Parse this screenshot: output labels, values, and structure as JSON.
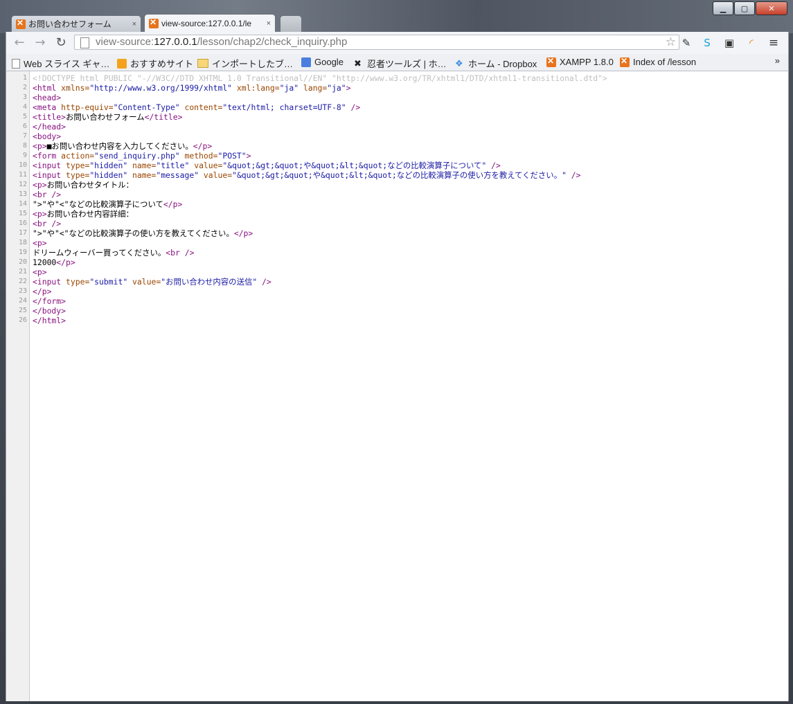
{
  "window": {
    "controls": [
      "▁",
      "▢",
      "✕"
    ]
  },
  "tabs": [
    {
      "title": "お問い合わせフォーム",
      "close": "×",
      "active": false
    },
    {
      "title": "view-source:127.0.0.1/le",
      "close": "×",
      "active": true
    }
  ],
  "toolbar": {
    "back_icon": "←",
    "forward_icon": "→",
    "reload_icon": "↻",
    "url_prefix": "view-source:",
    "url_host": "127.0.0.1",
    "url_path": "/lesson/chap2/check_inquiry.php",
    "star_icon": "☆",
    "extensions": [
      "eyedropper-icon",
      "skype-icon",
      "evernote-icon",
      "rss-icon",
      "menu-icon"
    ]
  },
  "bookmarks": [
    {
      "label": "Web スライス ギャ…",
      "icon": "page-icon"
    },
    {
      "label": "おすすめサイト",
      "icon": "bookmark-orange-icon"
    },
    {
      "label": "インポートしたブ…",
      "icon": "folder-icon"
    },
    {
      "label": "Google",
      "icon": "google-icon"
    },
    {
      "label": "忍者ツールズ | ホ…",
      "icon": "ninja-icon"
    },
    {
      "label": "ホーム - Dropbox",
      "icon": "dropbox-icon"
    },
    {
      "label": "XAMPP 1.8.0",
      "icon": "xampp-icon"
    },
    {
      "label": "Index of /lesson",
      "icon": "xampp-icon"
    }
  ],
  "bookmarks_more": "»",
  "source_lines": [
    {
      "n": "1",
      "parts": [
        [
          "doc",
          "<!DOCTYPE html PUBLIC \"-//W3C//DTD XHTML 1.0 Transitional//EN\" \"http://www.w3.org/TR/xhtml1/DTD/xhtml1-transitional.dtd\">"
        ]
      ]
    },
    {
      "n": "2",
      "parts": [
        [
          "tag",
          "<html "
        ],
        [
          "attr",
          "xmlns="
        ],
        [
          "val",
          "\"http://www.w3.org/1999/xhtml\""
        ],
        [
          "attr",
          " xml:lang="
        ],
        [
          "val",
          "\"ja\""
        ],
        [
          "attr",
          " lang="
        ],
        [
          "val",
          "\"ja\""
        ],
        [
          "tag",
          ">"
        ]
      ]
    },
    {
      "n": "3",
      "parts": [
        [
          "tag",
          "<head>"
        ]
      ]
    },
    {
      "n": "4",
      "parts": [
        [
          "tag",
          "<meta "
        ],
        [
          "attr",
          "http-equiv="
        ],
        [
          "val",
          "\"Content-Type\""
        ],
        [
          "attr",
          " content="
        ],
        [
          "val",
          "\"text/html; charset=UTF-8\""
        ],
        [
          "tag",
          " />"
        ]
      ]
    },
    {
      "n": "5",
      "parts": [
        [
          "tag",
          "<title>"
        ],
        [
          "txt",
          "お問い合わせフォーム"
        ],
        [
          "tag",
          "</title>"
        ]
      ]
    },
    {
      "n": "6",
      "parts": [
        [
          "tag",
          "</head>"
        ]
      ]
    },
    {
      "n": "7",
      "parts": [
        [
          "tag",
          "<body>"
        ]
      ]
    },
    {
      "n": "8",
      "parts": [
        [
          "tag",
          "<p>"
        ],
        [
          "txt",
          "■お問い合わせ内容を入力してください。"
        ],
        [
          "tag",
          "</p>"
        ]
      ]
    },
    {
      "n": "9",
      "parts": [
        [
          "tag",
          "<form "
        ],
        [
          "attr",
          "action="
        ],
        [
          "val",
          "\"send_inquiry.php\""
        ],
        [
          "attr",
          " method="
        ],
        [
          "val",
          "\"POST\""
        ],
        [
          "tag",
          ">"
        ]
      ]
    },
    {
      "n": "10",
      "parts": [
        [
          "tag",
          "<input "
        ],
        [
          "attr",
          "type="
        ],
        [
          "val",
          "\"hidden\""
        ],
        [
          "attr",
          " name="
        ],
        [
          "val",
          "\"title\""
        ],
        [
          "attr",
          " value="
        ],
        [
          "val",
          "\"&quot;&gt;&quot;や&quot;&lt;&quot;などの比較演算子について\""
        ],
        [
          "tag",
          " />"
        ]
      ]
    },
    {
      "n": "11",
      "parts": [
        [
          "tag",
          "<input "
        ],
        [
          "attr",
          "type="
        ],
        [
          "val",
          "\"hidden\""
        ],
        [
          "attr",
          " name="
        ],
        [
          "val",
          "\"message\""
        ],
        [
          "attr",
          " value="
        ],
        [
          "val",
          "\"&quot;&gt;&quot;や&quot;&lt;&quot;などの比較演算子の使い方を教えてください。\""
        ],
        [
          "tag",
          " />"
        ]
      ]
    },
    {
      "n": "12",
      "parts": [
        [
          "tag",
          "<p>"
        ],
        [
          "txt",
          "お問い合わせタイトル："
        ]
      ]
    },
    {
      "n": "13",
      "parts": [
        [
          "tag",
          "<br />"
        ]
      ]
    },
    {
      "n": "14",
      "parts": [
        [
          "txt",
          "\">\"や\"<\"などの比較演算子について"
        ],
        [
          "tag",
          "</p>"
        ]
      ]
    },
    {
      "n": "15",
      "parts": [
        [
          "tag",
          "<p>"
        ],
        [
          "txt",
          "お問い合わせ内容詳細："
        ]
      ]
    },
    {
      "n": "16",
      "parts": [
        [
          "tag",
          "<br />"
        ]
      ]
    },
    {
      "n": "17",
      "parts": [
        [
          "txt",
          "\">\"や\"<\"などの比較演算子の使い方を教えてください。"
        ],
        [
          "tag",
          "</p>"
        ]
      ]
    },
    {
      "n": "18",
      "parts": [
        [
          "tag",
          "<p>"
        ]
      ]
    },
    {
      "n": "19",
      "parts": [
        [
          "txt",
          "ドリームウィーバー買ってください。"
        ],
        [
          "tag",
          "<br />"
        ]
      ]
    },
    {
      "n": "20",
      "parts": [
        [
          "txt",
          "12000"
        ],
        [
          "tag",
          "</p>"
        ]
      ]
    },
    {
      "n": "21",
      "parts": [
        [
          "tag",
          "<p>"
        ]
      ]
    },
    {
      "n": "22",
      "parts": [
        [
          "tag",
          "<input "
        ],
        [
          "attr",
          "type="
        ],
        [
          "val",
          "\"submit\""
        ],
        [
          "attr",
          " value="
        ],
        [
          "val",
          "\"お問い合わせ内容の送信\""
        ],
        [
          "tag",
          " />"
        ]
      ]
    },
    {
      "n": "23",
      "parts": [
        [
          "tag",
          "</p>"
        ]
      ]
    },
    {
      "n": "24",
      "parts": [
        [
          "tag",
          "</form>"
        ]
      ]
    },
    {
      "n": "25",
      "parts": [
        [
          "tag",
          "</body>"
        ]
      ]
    },
    {
      "n": "26",
      "parts": [
        [
          "tag",
          "</html>"
        ]
      ]
    }
  ]
}
